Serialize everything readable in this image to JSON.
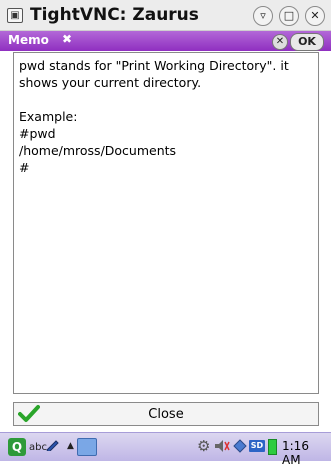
{
  "window": {
    "title": "TightVNC: Zaurus",
    "controls": [
      "minimize-icon",
      "maximize-icon",
      "close-icon"
    ]
  },
  "app": {
    "title": "Memo",
    "ok_label": "OK"
  },
  "memo": {
    "lines": [
      "pwd stands for \"Print Working Directory\". it",
      "shows your current directory.",
      "",
      "Example:",
      "#pwd",
      "/home/mross/Documents",
      "#"
    ]
  },
  "close_bar": {
    "label": "Close"
  },
  "taskbar": {
    "input_label": "abc",
    "storage_label": "SD",
    "time": "1:16 AM"
  },
  "colors": {
    "header_purple": "#9b40c8",
    "taskbar_lavender": "#cfc8ee",
    "check_green": "#2aa52a"
  }
}
